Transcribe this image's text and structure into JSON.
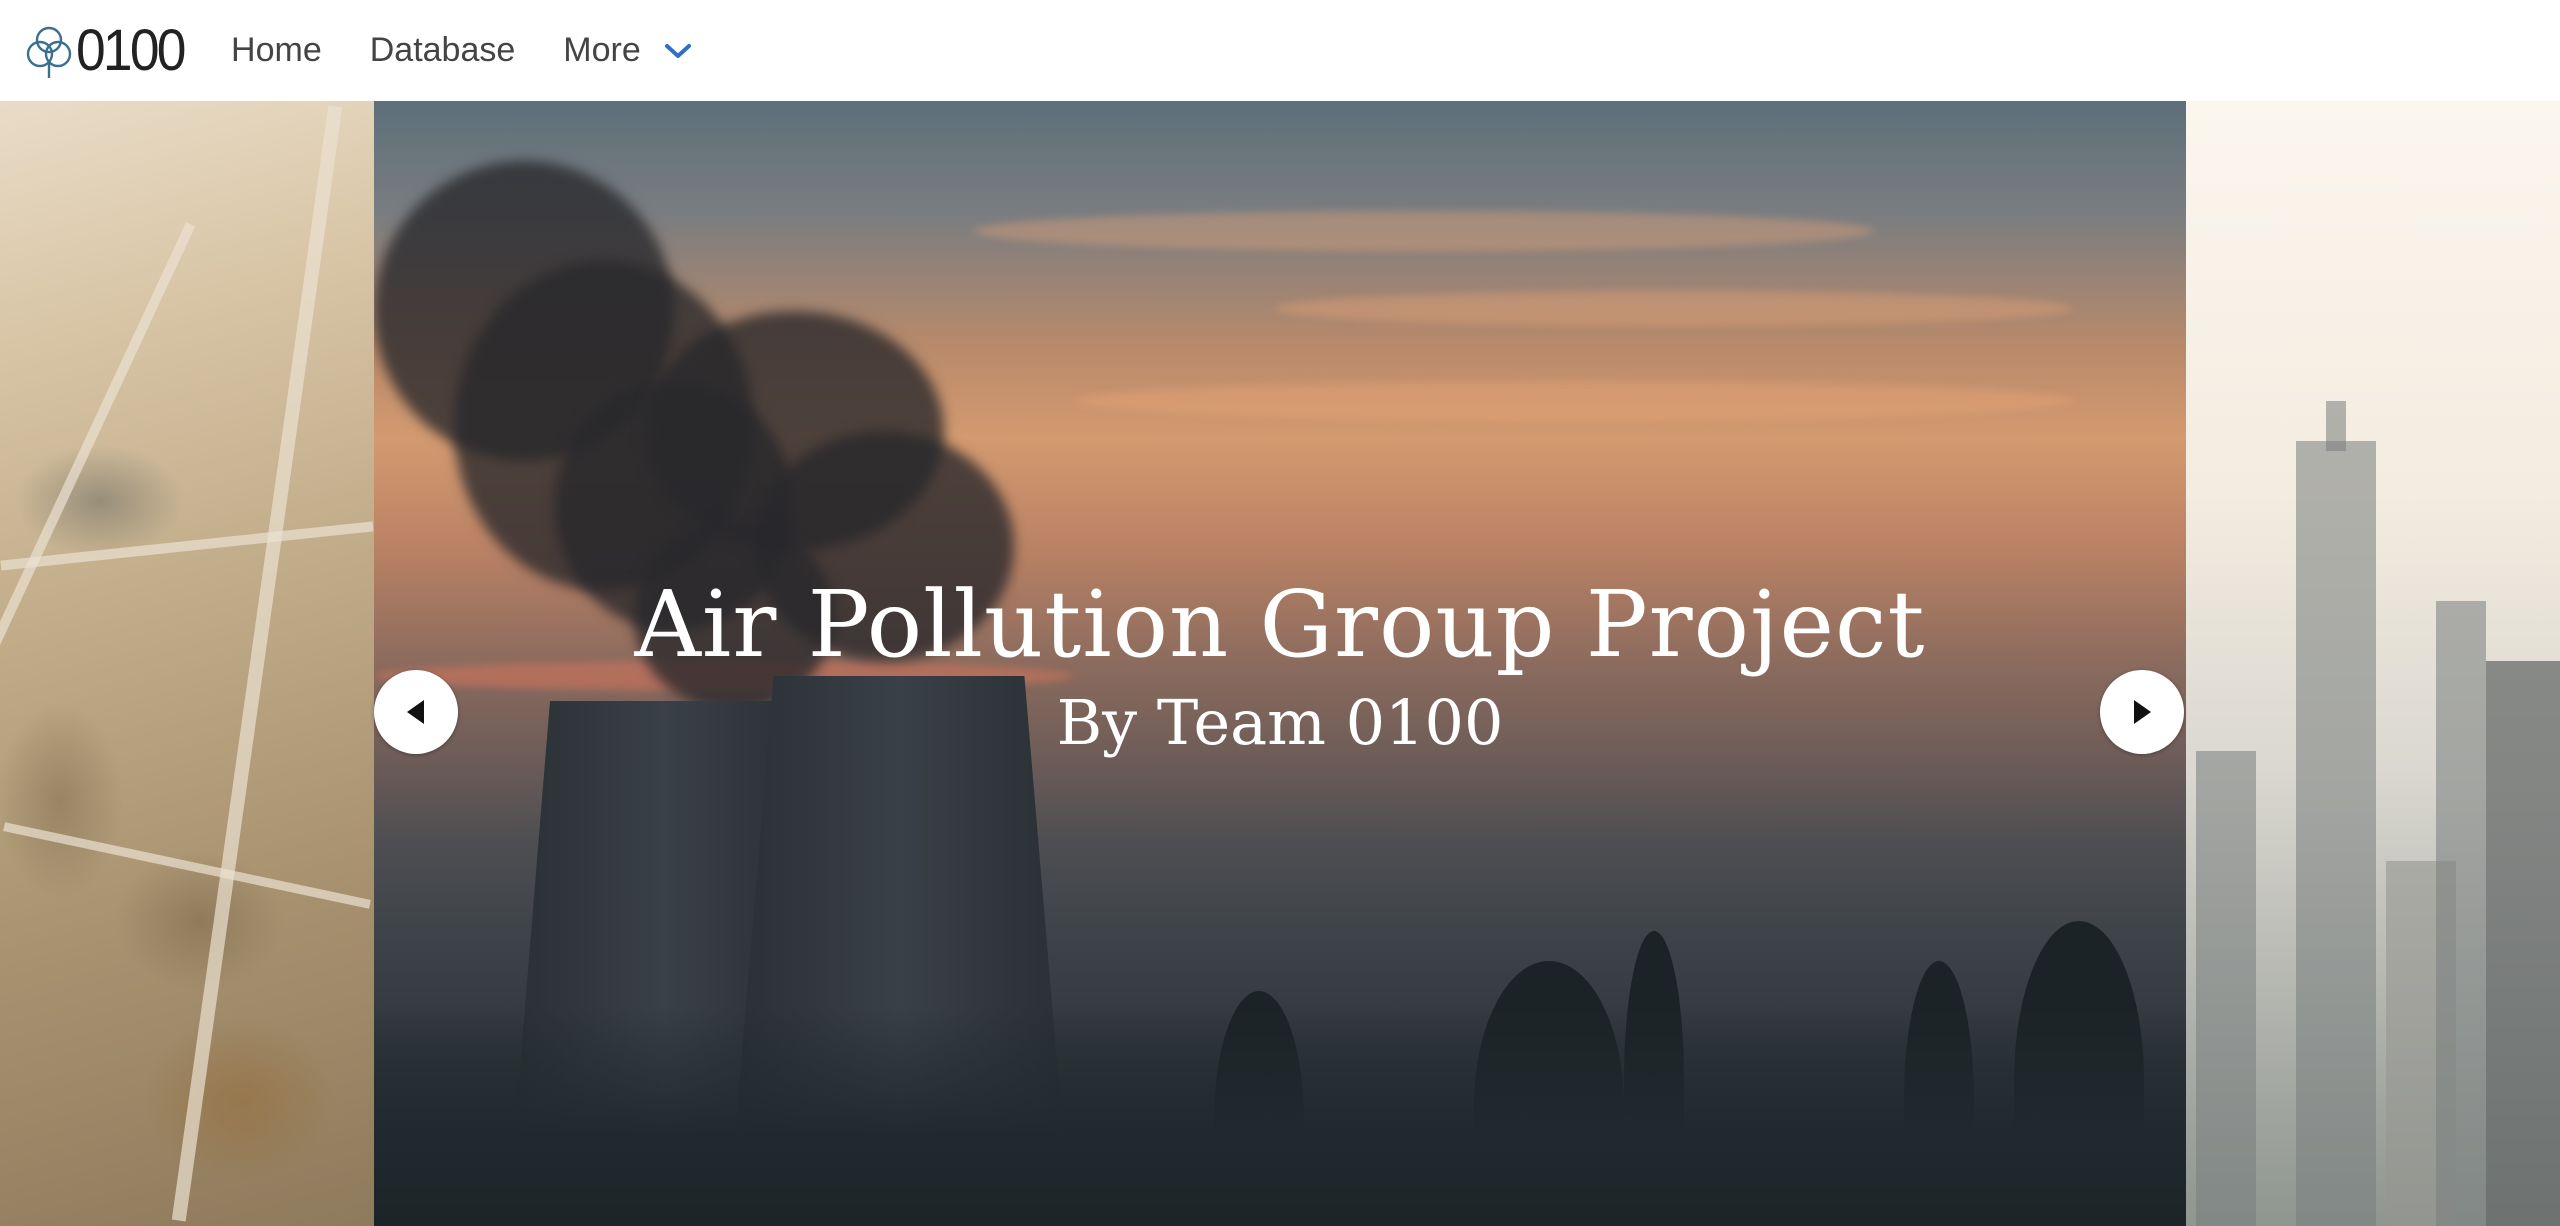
{
  "brand": {
    "text": "0100",
    "logo_icon": "trinity-knot-icon"
  },
  "nav": {
    "home": "Home",
    "database": "Database",
    "more": "More"
  },
  "colors": {
    "accent": "#2f6fc4",
    "caption_text": "#ffffff"
  },
  "carousel": {
    "title": "Air Pollution Group Project",
    "subtitle": "By Team 0100",
    "prev_icon": "caret-left-icon",
    "next_icon": "caret-right-icon"
  }
}
